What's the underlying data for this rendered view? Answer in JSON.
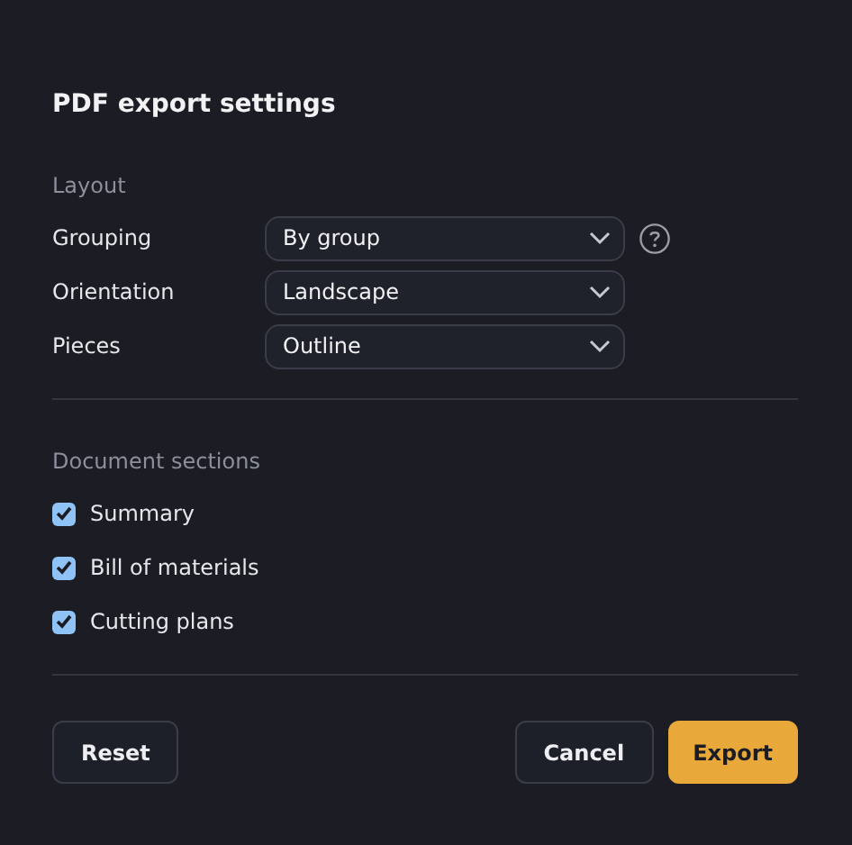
{
  "dialog": {
    "title": "PDF export settings"
  },
  "layout_section": {
    "heading": "Layout",
    "fields": [
      {
        "label": "Grouping",
        "value": "By group",
        "help": true
      },
      {
        "label": "Orientation",
        "value": "Landscape",
        "help": false
      },
      {
        "label": "Pieces",
        "value": "Outline",
        "help": false
      }
    ]
  },
  "sections": {
    "heading": "Document sections",
    "items": [
      {
        "label": "Summary",
        "checked": true
      },
      {
        "label": "Bill of materials",
        "checked": true
      },
      {
        "label": "Cutting plans",
        "checked": true
      }
    ]
  },
  "footer": {
    "left": [
      {
        "label": "Reset",
        "kind": "secondary"
      }
    ],
    "right": [
      {
        "label": "Cancel",
        "kind": "secondary"
      },
      {
        "label": "Export",
        "kind": "primary"
      }
    ]
  }
}
